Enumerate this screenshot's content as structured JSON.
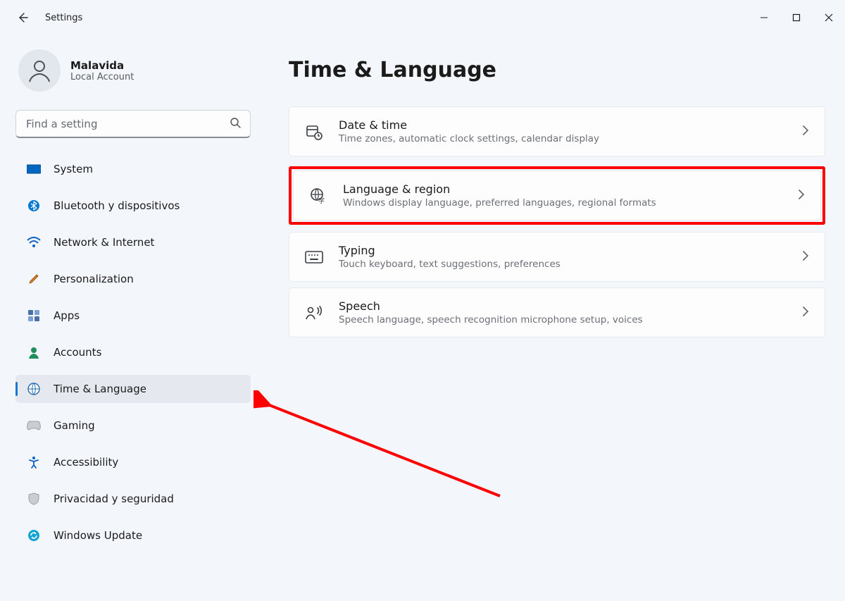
{
  "app": {
    "title": "Settings"
  },
  "user": {
    "name": "Malavida",
    "account_type": "Local Account"
  },
  "search": {
    "placeholder": "Find a setting"
  },
  "sidebar": {
    "items": [
      {
        "label": "System"
      },
      {
        "label": "Bluetooth y dispositivos"
      },
      {
        "label": "Network & Internet"
      },
      {
        "label": "Personalization"
      },
      {
        "label": "Apps"
      },
      {
        "label": "Accounts"
      },
      {
        "label": "Time & Language"
      },
      {
        "label": "Gaming"
      },
      {
        "label": "Accessibility"
      },
      {
        "label": "Privacidad y seguridad"
      },
      {
        "label": "Windows Update"
      }
    ]
  },
  "page": {
    "title": "Time & Language"
  },
  "cards": [
    {
      "title": "Date & time",
      "desc": "Time zones, automatic clock settings, calendar display"
    },
    {
      "title": "Language & region",
      "desc": "Windows display language, preferred languages, regional formats"
    },
    {
      "title": "Typing",
      "desc": "Touch keyboard, text suggestions, preferences"
    },
    {
      "title": "Speech",
      "desc": "Speech language, speech recognition microphone setup, voices"
    }
  ]
}
